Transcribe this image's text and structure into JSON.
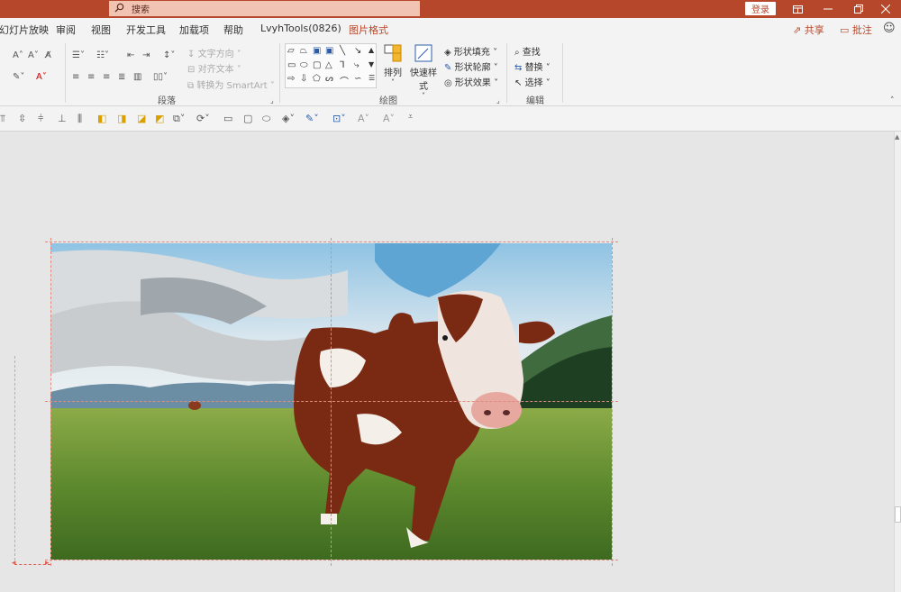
{
  "titlebar": {
    "search_placeholder": "搜索",
    "login_label": "登录",
    "window_controls": [
      "ribbon-display-icon",
      "minimize-icon",
      "restore-icon",
      "close-icon"
    ]
  },
  "tabs": [
    {
      "label": "幻灯片放映",
      "active": false
    },
    {
      "label": "审阅",
      "active": false
    },
    {
      "label": "视图",
      "active": false
    },
    {
      "label": "开发工具",
      "active": false
    },
    {
      "label": "加载项",
      "active": false
    },
    {
      "label": "帮助",
      "active": false
    },
    {
      "label": "LvyhTools(0826)",
      "active": false
    },
    {
      "label": "图片格式",
      "active": true
    }
  ],
  "header_actions": {
    "share": "共享",
    "comment": "批注"
  },
  "ribbon": {
    "paragraph": {
      "text_direction": "文字方向",
      "align_text": "对齐文本",
      "convert_smartart": "转换为 SmartArt",
      "group_label": "段落"
    },
    "drawing": {
      "arrange": "排列",
      "quick_styles": "快速样式",
      "shape_fill": "形状填充",
      "shape_outline": "形状轮廓",
      "shape_effects": "形状效果",
      "group_label": "绘图"
    },
    "editing": {
      "find": "查找",
      "replace": "替换",
      "select": "选择",
      "group_label": "编辑"
    }
  },
  "colors": {
    "accent": "#b7472a",
    "search_bg": "#f1c3b3",
    "canvas_bg": "#e6e6e6",
    "guide": "#e08a80"
  }
}
